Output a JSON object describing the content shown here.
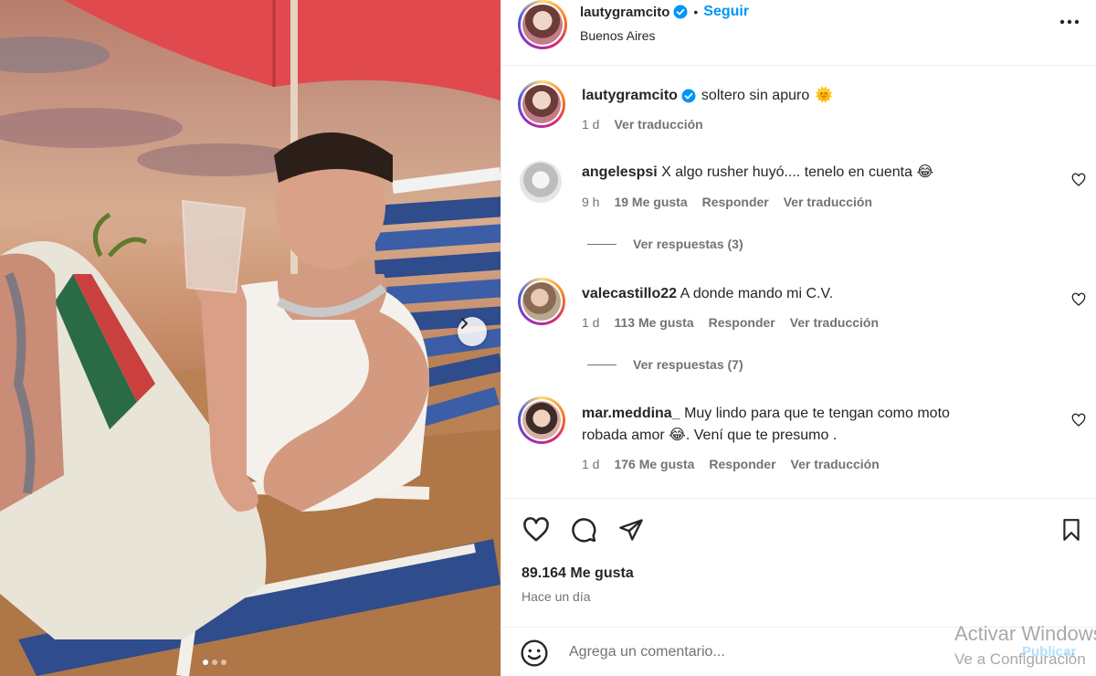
{
  "header": {
    "username": "lautygramcito",
    "follow_label": "Seguir",
    "separator": "•",
    "location": "Buenos Aires"
  },
  "caption": {
    "username": "lautygramcito",
    "text": "soltero sin apuro",
    "emoji": "🌞",
    "time": "1 d",
    "translate": "Ver traducción"
  },
  "comments": [
    {
      "username": "angelespsi",
      "text": "X algo rusher huyó.... tenelo en cuenta 😂",
      "time": "9 h",
      "likes": "19 Me gusta",
      "reply": "Responder",
      "translate": "Ver traducción",
      "view_replies": "Ver respuestas (3)"
    },
    {
      "username": "valecastillo22",
      "text": "A donde mando mi C.V.",
      "time": "1 d",
      "likes": "113 Me gusta",
      "reply": "Responder",
      "translate": "Ver traducción",
      "view_replies": "Ver respuestas (7)"
    },
    {
      "username": "mar.meddina_",
      "text": "Muy lindo para que te tengan como moto",
      "text2": "robada amor 😂. Vení que te presumo .",
      "time": "1 d",
      "likes": "176 Me gusta",
      "reply": "Responder",
      "translate": "Ver traducción"
    }
  ],
  "actions": {
    "likes": "89.164 Me gusta",
    "time_ago": "Hace un día",
    "icons": [
      "heart-icon",
      "comment-icon",
      "share-icon",
      "bookmark-icon"
    ]
  },
  "comment_box": {
    "placeholder": "Agrega un comentario...",
    "publish": "Publicar"
  },
  "watermark": {
    "line1": "Activar Windows",
    "line2": "Ve a Configuración"
  },
  "colors": {
    "accent": "#0095f6",
    "verified": "#0095f6",
    "text": "#262626",
    "secondary": "#737373"
  }
}
